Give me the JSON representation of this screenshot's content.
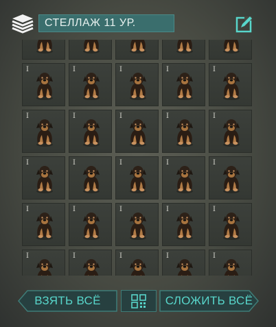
{
  "header": {
    "icon": "storage-rack-icon",
    "title": "СТЕЛЛАЖ 11 УР.",
    "rename_icon": "edit-icon"
  },
  "inventory": {
    "item_icon": "puppy-icon",
    "slots": [
      {
        "qty": ""
      },
      {
        "qty": ""
      },
      {
        "qty": ""
      },
      {
        "qty": ""
      },
      {
        "qty": ""
      },
      {
        "qty": "I"
      },
      {
        "qty": "I"
      },
      {
        "qty": "I"
      },
      {
        "qty": "I"
      },
      {
        "qty": "I"
      },
      {
        "qty": "I"
      },
      {
        "qty": "I"
      },
      {
        "qty": "I"
      },
      {
        "qty": "I"
      },
      {
        "qty": "I"
      },
      {
        "qty": "I"
      },
      {
        "qty": "I"
      },
      {
        "qty": "I"
      },
      {
        "qty": "I"
      },
      {
        "qty": "I"
      },
      {
        "qty": "I"
      },
      {
        "qty": "I"
      },
      {
        "qty": "I"
      },
      {
        "qty": "I"
      },
      {
        "qty": "I"
      },
      {
        "qty": "I"
      },
      {
        "qty": "I"
      },
      {
        "qty": "I"
      },
      {
        "qty": "I"
      },
      {
        "qty": "I"
      }
    ]
  },
  "actions": {
    "take_all": "ВЗЯТЬ ВСЁ",
    "sort_icon": "grid-sort-icon",
    "store_all": "СЛОЖИТЬ ВСЁ"
  },
  "colors": {
    "accent": "#58d6cb",
    "title_bg": "#3a6e6d",
    "button_bg": "#274040"
  }
}
